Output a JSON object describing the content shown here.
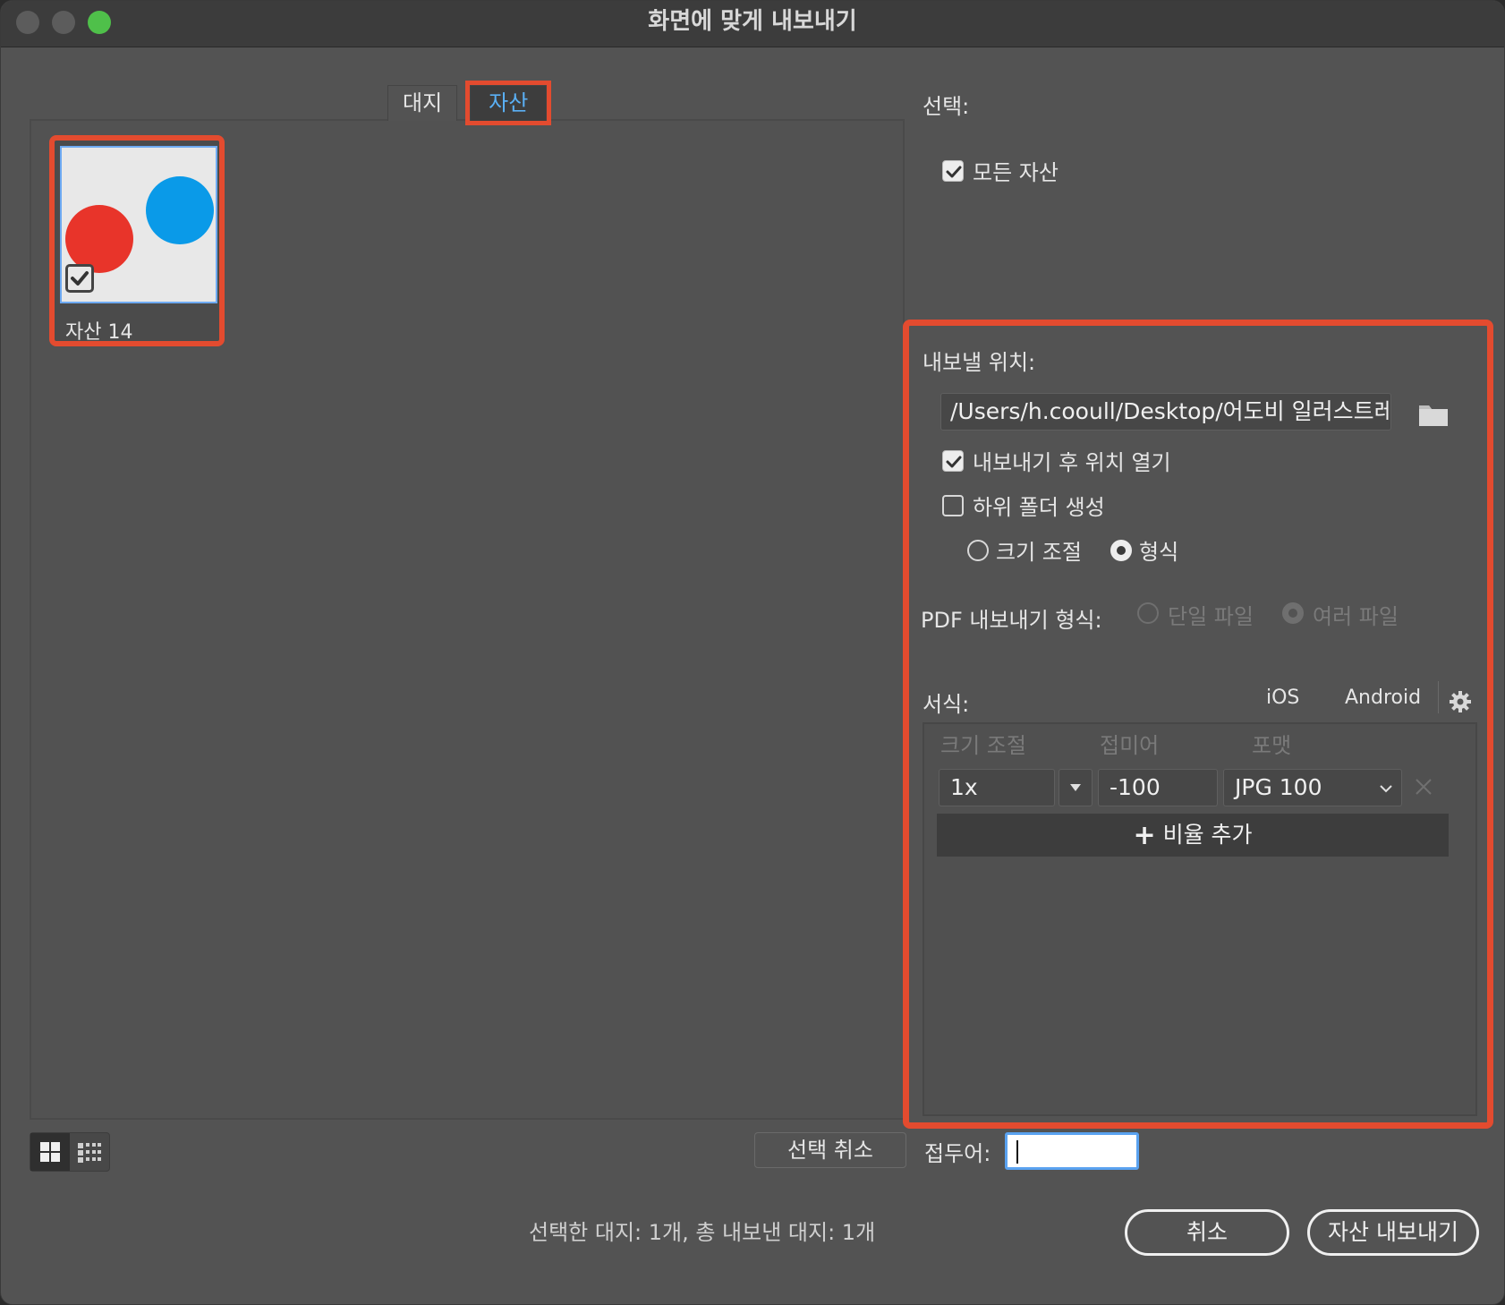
{
  "window": {
    "title": "화면에 맞게 내보내기"
  },
  "tabs": [
    {
      "label": "대지"
    },
    {
      "label": "자산"
    }
  ],
  "assets": [
    {
      "label": "자산 14",
      "checked": true
    }
  ],
  "selection": {
    "label": "선택:",
    "all_assets": "모든 자산"
  },
  "export_to": {
    "label": "내보낼 위치:",
    "path": "/Users/h.cooull/Desktop/어도비 일러스트레이",
    "open_after": "내보내기 후 위치 열기",
    "subfolders": "하위 폴더 생성",
    "by_scale": "크기 조절",
    "by_format": "형식"
  },
  "pdf": {
    "label": "PDF 내보내기 형식:",
    "single": "단일 파일",
    "multiple": "여러 파일"
  },
  "formats": {
    "label": "서식:",
    "ios": "iOS",
    "android": "Android",
    "col_scale": "크기 조절",
    "col_suffix": "접미어",
    "col_format": "포맷",
    "row": {
      "scale": "1x",
      "suffix": "-100",
      "format": "JPG 100"
    },
    "add_scale": "비율 추가"
  },
  "footer": {
    "deselect": "선택 취소",
    "prefix_label": "접두어:",
    "prefix_value": "",
    "status": "선택한 대지: 1개, 총 내보낸 대지: 1개",
    "cancel": "취소",
    "export": "자산 내보내기"
  },
  "colors": {
    "accent_red": "#e34b2f",
    "circle_red": "#e8342a",
    "circle_blue": "#0a9ae8",
    "tab_active": "#5ab0f5"
  }
}
